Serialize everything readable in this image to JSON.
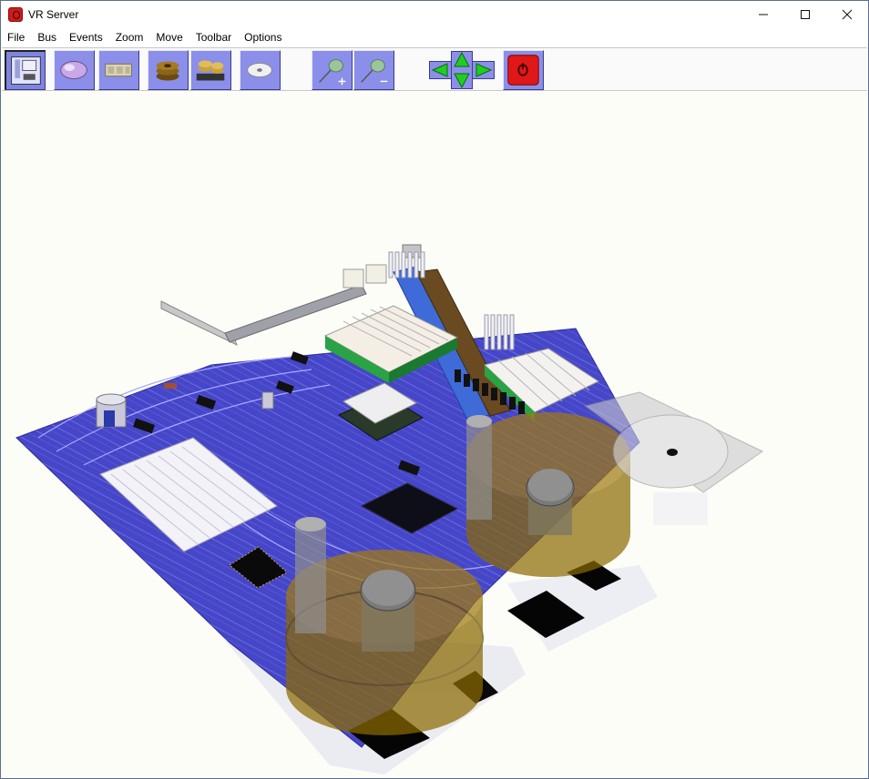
{
  "window": {
    "title": "VR Server"
  },
  "menu": [
    "File",
    "Bus",
    "Events",
    "Zoom",
    "Move",
    "Toolbar",
    "Options"
  ],
  "toolbar": {
    "buttons": [
      {
        "name": "board-view-button",
        "icon": "motherboard-icon",
        "pressed": true
      },
      {
        "name": "mouse-button",
        "icon": "mouse-icon",
        "pressed": false
      },
      {
        "name": "chips-button",
        "icon": "chips-icon",
        "pressed": false
      },
      {
        "name": "disk-stack-button",
        "icon": "disk-stack-icon",
        "pressed": false
      },
      {
        "name": "gear-stack-button",
        "icon": "gear-stack-icon",
        "pressed": false
      },
      {
        "name": "disc-button",
        "icon": "disc-icon",
        "pressed": false
      },
      {
        "name": "zoom-in-button",
        "icon": "zoom-in-icon",
        "pressed": false
      },
      {
        "name": "zoom-out-button",
        "icon": "zoom-out-icon",
        "pressed": false
      },
      {
        "name": "move-left-button",
        "icon": "arrow-left-icon",
        "pressed": false
      },
      {
        "name": "move-up-button",
        "icon": "arrow-up-icon",
        "pressed": false
      },
      {
        "name": "move-down-button",
        "icon": "arrow-down-icon",
        "pressed": false
      },
      {
        "name": "move-right-button",
        "icon": "arrow-right-icon",
        "pressed": false
      },
      {
        "name": "stop-button",
        "icon": "stop-icon",
        "pressed": false
      }
    ]
  },
  "colors": {
    "accent_button": "#8b8fe9",
    "board": "#4646c8",
    "trace": "#9a9cff",
    "gold": "#8a6a00",
    "stop": "#e01818",
    "arrow": "#22cc22"
  }
}
